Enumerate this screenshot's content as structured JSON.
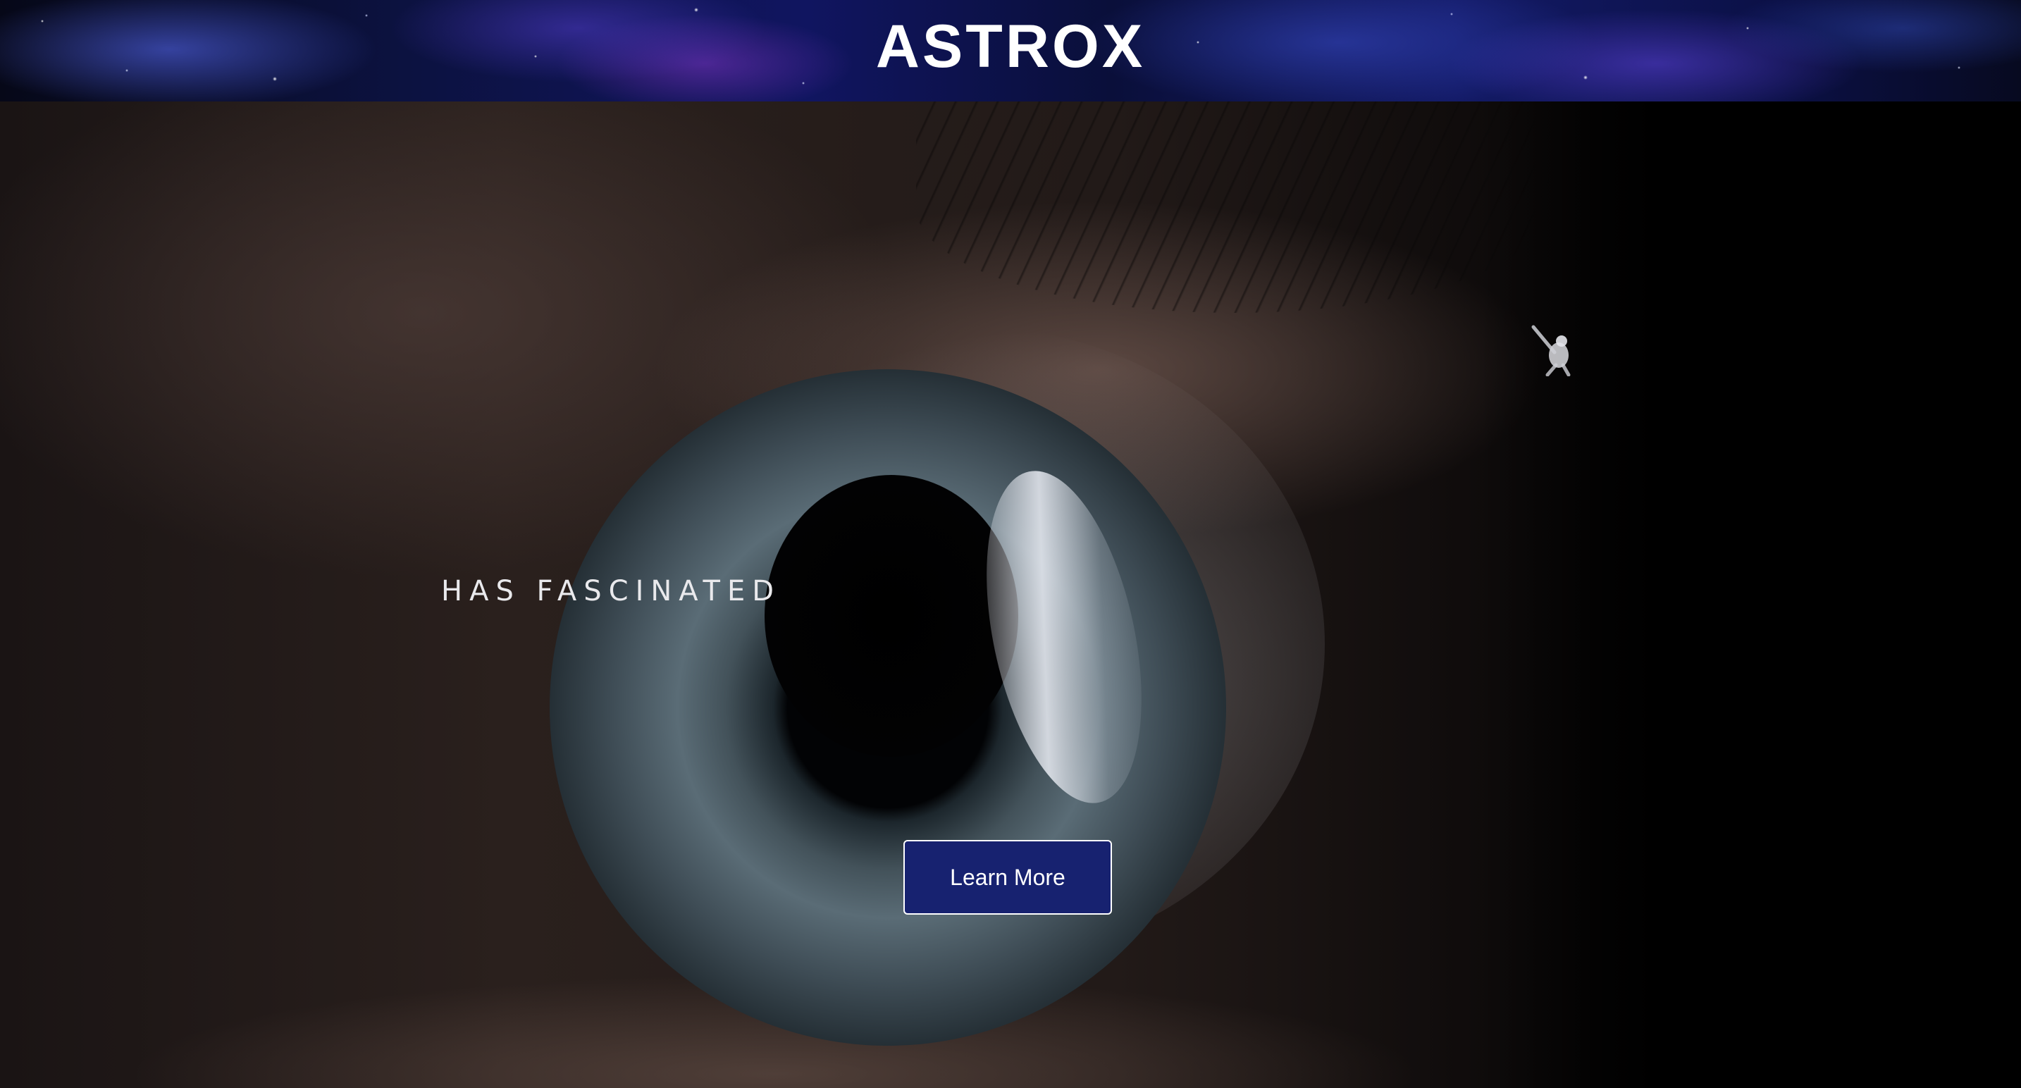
{
  "header": {
    "brand": "ASTROX"
  },
  "hero": {
    "tagline": "HAS FASCINATED",
    "cta_label": "Learn More"
  },
  "colors": {
    "cta_background": "#172270",
    "cta_border": "#ffffff",
    "header_accent": "#101560",
    "text": "#ffffff"
  },
  "icons": {
    "astronaut": "astronaut-icon"
  }
}
